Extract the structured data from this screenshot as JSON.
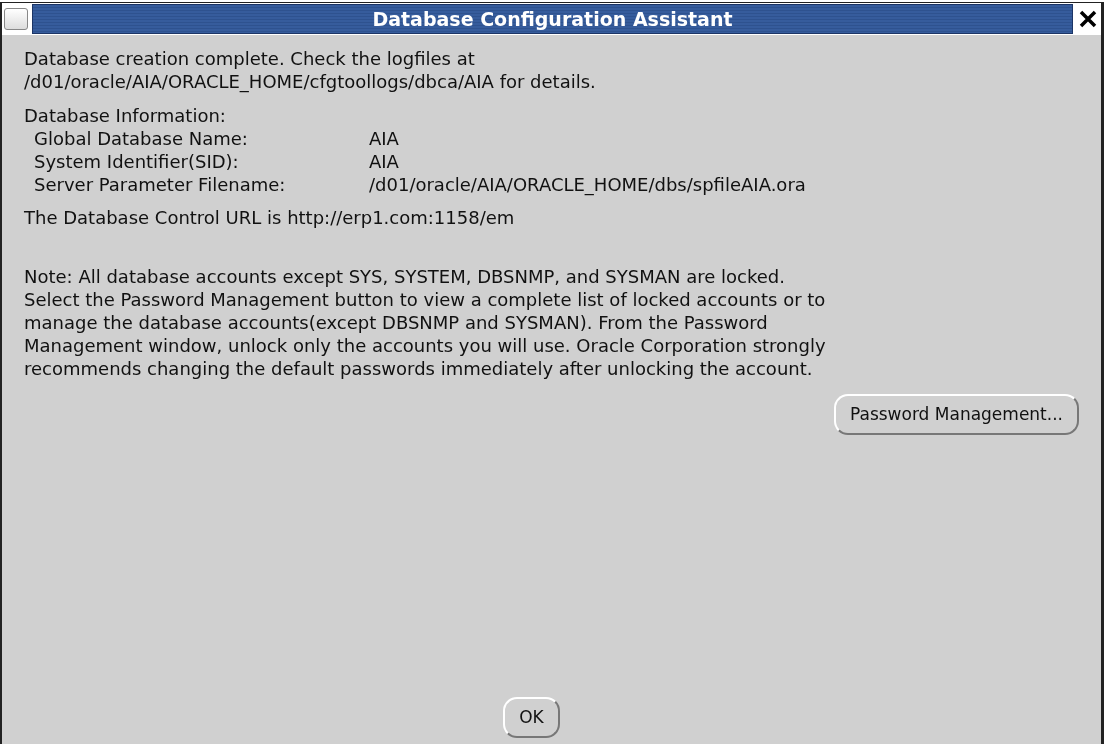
{
  "window": {
    "title": "Database Configuration Assistant"
  },
  "completion_message": "Database creation complete. Check the logfiles at\n/d01/oracle/AIA/ORACLE_HOME/cfgtoollogs/dbca/AIA for details.",
  "info": {
    "heading": "Database Information:",
    "fields": [
      {
        "label": "Global Database Name:",
        "value": "AIA"
      },
      {
        "label": "System Identifier(SID):",
        "value": "AIA"
      },
      {
        "label": "Server Parameter Filename:",
        "value": "/d01/oracle/AIA/ORACLE_HOME/dbs/spfileAIA.ora"
      }
    ]
  },
  "url_message": "The Database Control URL is http://erp1.com:1158/em",
  "note": "Note: All database accounts except SYS, SYSTEM, DBSNMP, and SYSMAN are locked.\nSelect the Password Management button to view a complete list of locked accounts or to\nmanage the database accounts(except DBSNMP and SYSMAN). From the Password\nManagement window, unlock only the accounts you will use. Oracle Corporation strongly\nrecommends changing the default passwords immediately after unlocking the account.",
  "password_button": "Password Management...",
  "ok_button": "OK"
}
